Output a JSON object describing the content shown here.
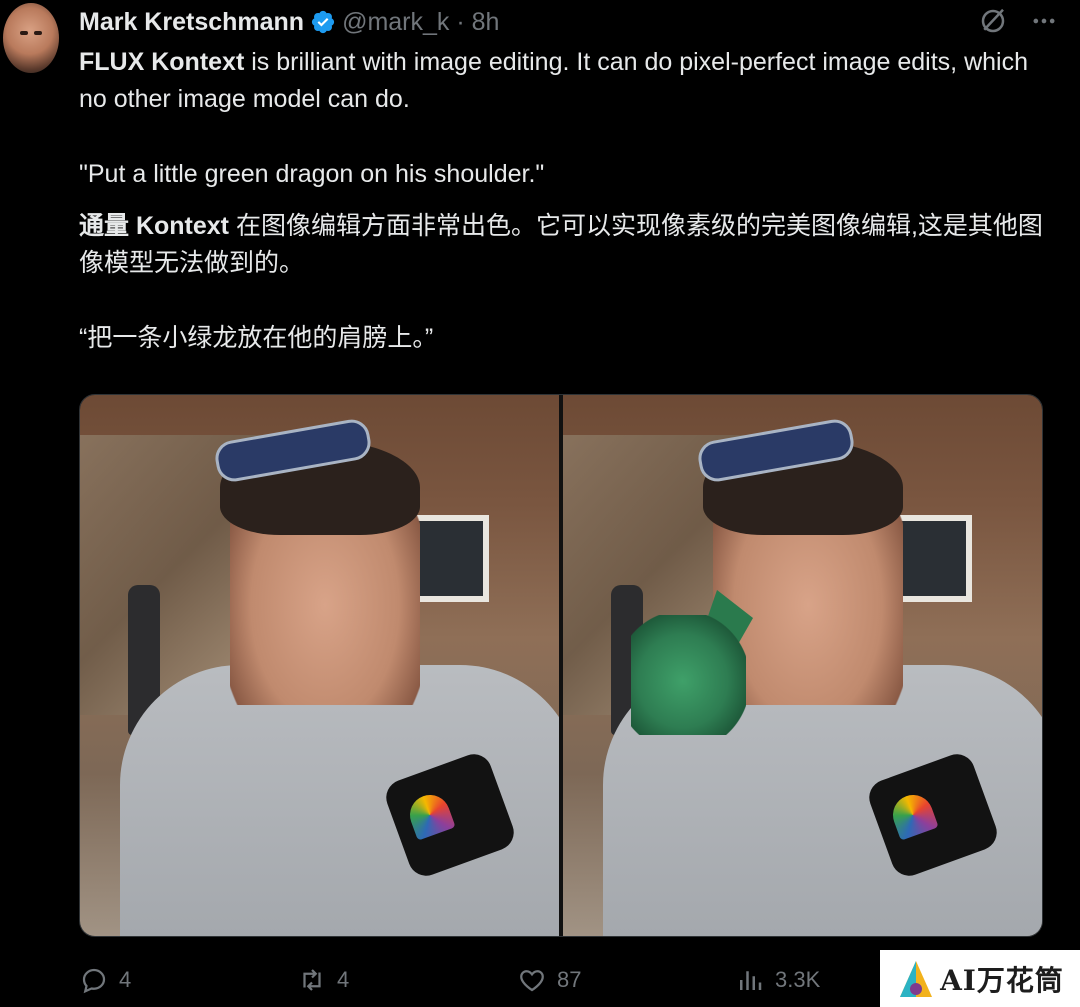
{
  "header": {
    "name": "Mark Kretschmann",
    "handle": "@mark_k · 8h"
  },
  "tweet": {
    "en_bold": "FLUX Kontext",
    "en_rest": " is brilliant with image editing. It can do pixel-perfect image edits, which no other image model can do.",
    "en_quote": "\"Put a little green dragon on his shoulder.\"",
    "zh_bold": "通量 Kontext",
    "zh_rest": " 在图像编辑方面非常出色。它可以实现像素级的完美图像编辑,这是其他图像模型无法做到的。",
    "zh_quote": "“把一条小绿龙放在他的肩膀上。”"
  },
  "actions": {
    "replies": "4",
    "retweets": "4",
    "likes": "87",
    "views": "3.3K"
  },
  "watermark": {
    "text": "AI万花筒"
  },
  "icons": {
    "verified": "verified-badge-icon",
    "grok": "grok-icon",
    "more": "more-icon",
    "reply": "reply-icon",
    "retweet": "retweet-icon",
    "like": "like-icon",
    "views": "views-icon"
  },
  "colors": {
    "background": "#000000",
    "text": "#e7e9ea",
    "muted": "#71767b",
    "verified": "#1d9bf0"
  }
}
